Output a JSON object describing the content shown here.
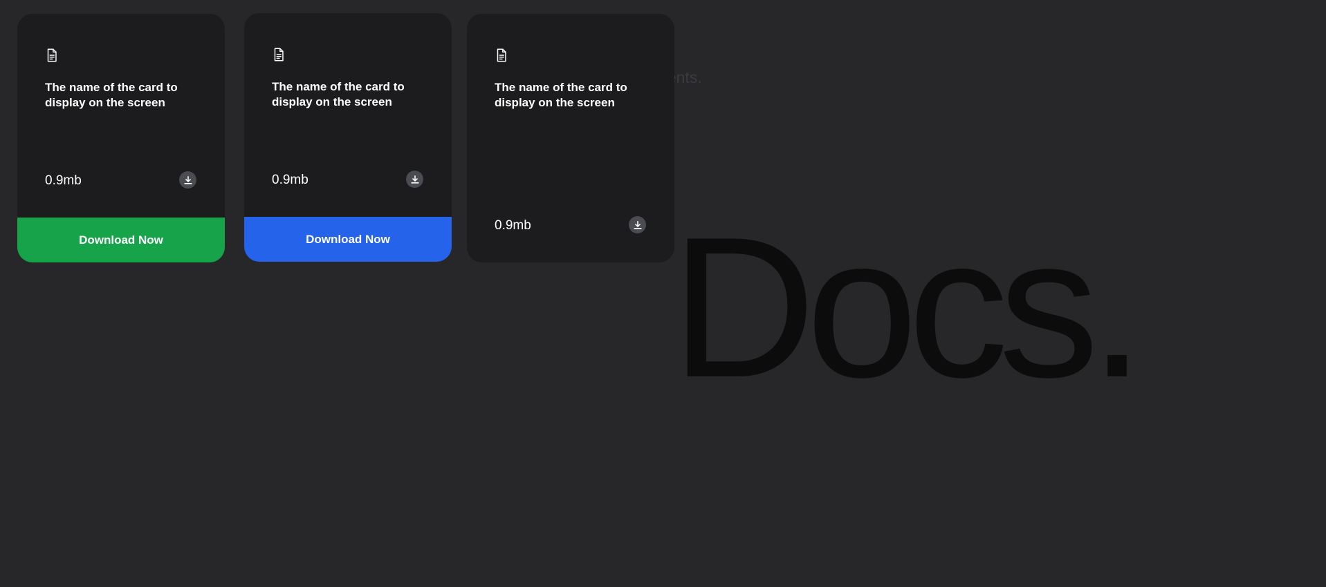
{
  "background": {
    "title": "Docs.",
    "subtitle": "Documents."
  },
  "colors": {
    "page_bg": "#27272a",
    "card_bg": "#1c1c1e",
    "green": "#16a34a",
    "blue": "#2563eb",
    "icon_circle": "#4b4b52"
  },
  "cards": [
    {
      "icon": "document-icon",
      "title": "The name of the card to display on the screen",
      "size": "0.9mb",
      "download_icon": "download-icon",
      "button_label": "Download Now",
      "button_color": "#16a34a"
    },
    {
      "icon": "document-icon",
      "title": "The name of the card to display on the screen",
      "size": "0.9mb",
      "download_icon": "download-icon",
      "button_label": "Download Now",
      "button_color": "#2563eb"
    },
    {
      "icon": "document-icon",
      "title": "The name of the card to display on the screen",
      "size": "0.9mb",
      "download_icon": "download-icon"
    }
  ]
}
